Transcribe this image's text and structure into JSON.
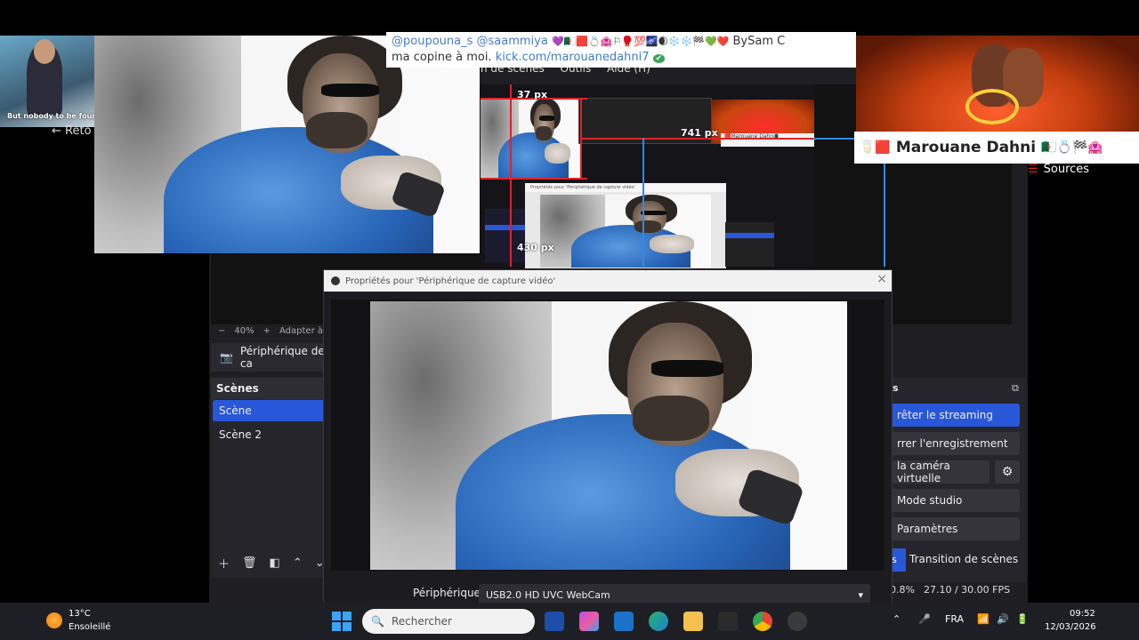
{
  "obs": {
    "menu": [
      "n de scènes",
      "Outils",
      "Aide (H)"
    ],
    "zoom_minus": "−",
    "zoom_level": "40%",
    "zoom_plus": "+",
    "zoom_fit": "Adapter à",
    "source_name": "Périphérique de ca",
    "sources_label": "Sources",
    "scenes_title": "Scènes",
    "scenes": [
      "Scène",
      "Scène 2"
    ],
    "controls": [
      "rêter le streaming",
      "rrer l'enregistrement",
      "la caméra virtuelle",
      "Mode studio",
      "Paramètres"
    ],
    "transition_prefix": "s",
    "transition_label": "Transition de scènes",
    "controls_title_suffix": "s",
    "status_cpu": "0.8%",
    "status_fps": "27.10 / 30.00 FPS"
  },
  "dialog": {
    "title": "Propriétés pour 'Périphérique de capture vidéo'",
    "close": "×",
    "device_label": "Périphérique",
    "device_value": "USB2.0 HD UVC WebCam"
  },
  "overlays": {
    "chat_user1": "@poupouna_s",
    "chat_user2": "@saammiya",
    "chat_emoji": "💜🇩🇿🟥💍🏩⚐🥊💯🌌🌒❄️❄️🏁💚❤️",
    "chat_sig": "BySam C",
    "chat_line2": "ma copine à moi.",
    "chat_link": "kick.com/marouanedahni7",
    "chat_check": "✔",
    "name_emoji_left": "🥛🟥",
    "name": "Marouane Dahni",
    "name_emoji_right": "🇩🇿💍🏁🏩",
    "thumb_text": "But nobody to be found",
    "back_link": "Reto",
    "px_top": "37 px",
    "px_left": "430 px",
    "px_right": "741 px",
    "nested_title": "Propriétés pour 'Périphérique de capture vidéo'",
    "nested_name": "🟥Marouane Dahni🇩🇿"
  },
  "taskbar": {
    "temperature": "13°C",
    "weather": "Ensoleillé",
    "search_placeholder": "Rechercher",
    "language": "FRA",
    "time": "09:52",
    "date": "12/03/2026"
  }
}
